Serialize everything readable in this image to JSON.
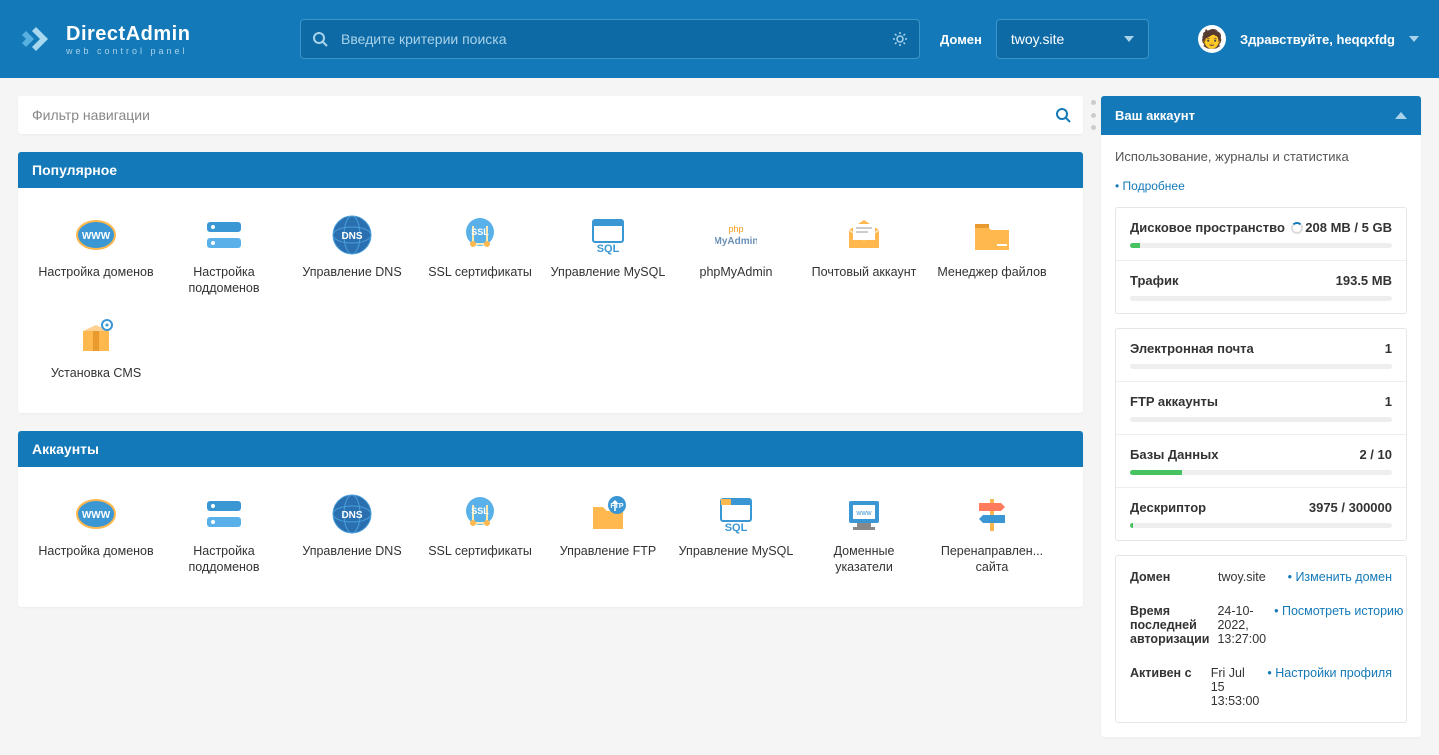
{
  "header": {
    "logo_title": "DirectAdmin",
    "logo_subtitle": "web control panel",
    "search_placeholder": "Введите критерии поиска",
    "domain_label": "Домен",
    "domain_value": "twoy.site",
    "greeting": "Здравствуйте,",
    "username": "heqqxfdg"
  },
  "filter": {
    "placeholder": "Фильтр навигации"
  },
  "sections": {
    "popular": {
      "title": "Популярное",
      "items": [
        {
          "label": "Настройка доменов",
          "icon": "www"
        },
        {
          "label": "Настройка поддоменов",
          "icon": "subdomain"
        },
        {
          "label": "Управление DNS",
          "icon": "dns"
        },
        {
          "label": "SSL сертификаты",
          "icon": "ssl"
        },
        {
          "label": "Управление MySQL",
          "icon": "sql"
        },
        {
          "label": "phpMyAdmin",
          "icon": "pma"
        },
        {
          "label": "Почтовый аккаунт",
          "icon": "mail"
        },
        {
          "label": "Менеджер файлов",
          "icon": "folder"
        },
        {
          "label": "Установка CMS",
          "icon": "box"
        }
      ]
    },
    "accounts": {
      "title": "Аккаунты",
      "items": [
        {
          "label": "Настройка доменов",
          "icon": "www"
        },
        {
          "label": "Настройка поддоменов",
          "icon": "subdomain"
        },
        {
          "label": "Управление DNS",
          "icon": "dns"
        },
        {
          "label": "SSL сертификаты",
          "icon": "ssl"
        },
        {
          "label": "Управление FTP",
          "icon": "ftp"
        },
        {
          "label": "Управление MySQL",
          "icon": "sql2"
        },
        {
          "label": "Доменные указатели",
          "icon": "pointer"
        },
        {
          "label": "Перенаправлен... сайта",
          "icon": "sign"
        }
      ]
    }
  },
  "account_panel": {
    "title": "Ваш аккаунт",
    "subtitle": "Использование, журналы и статистика",
    "more_link": "Подробнее",
    "stats1": [
      {
        "label": "Дисковое пространство",
        "value": "208 MB / 5 GB",
        "percent": 4,
        "spinner": true
      },
      {
        "label": "Трафик",
        "value": "193.5 MB",
        "percent": 0
      }
    ],
    "stats2": [
      {
        "label": "Электронная почта",
        "value": "1",
        "percent": 0
      },
      {
        "label": "FTP аккаунты",
        "value": "1",
        "percent": 0
      },
      {
        "label": "Базы Данных",
        "value": "2 / 10",
        "percent": 20
      },
      {
        "label": "Дескриптор",
        "value": "3975 / 300000",
        "percent": 1
      }
    ],
    "info": [
      {
        "label": "Домен",
        "value": "twoy.site",
        "link": "Изменить домен"
      },
      {
        "label": "Время последней авторизации",
        "value": "24-10-2022, 13:27:00",
        "link": "Посмотреть историю"
      },
      {
        "label": "Активен с",
        "value": "Fri Jul 15 13:53:00",
        "link": "Настройки профиля"
      }
    ]
  }
}
